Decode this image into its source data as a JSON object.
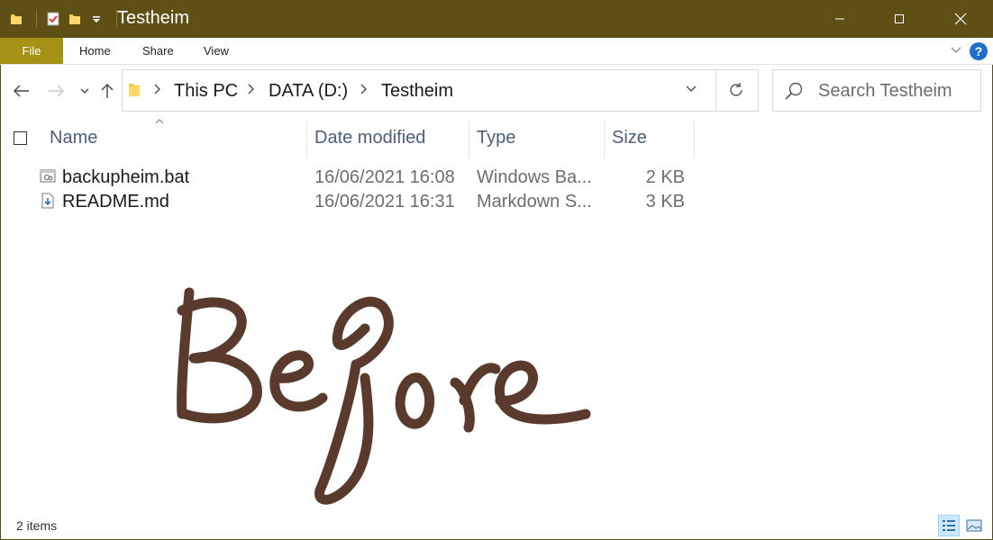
{
  "window": {
    "title": "Testheim",
    "title_bar_color": "#5e4f15",
    "accent_color": "#a59115"
  },
  "quick_access": {
    "icons": [
      "folder-icon",
      "properties-icon",
      "new-folder-icon",
      "customize-dropdown-icon"
    ]
  },
  "ribbon": {
    "tabs": [
      {
        "label": "File",
        "active": true
      },
      {
        "label": "Home"
      },
      {
        "label": "Share"
      },
      {
        "label": "View"
      }
    ],
    "help_label": "?"
  },
  "address_bar": {
    "breadcrumbs": [
      "This PC",
      "DATA (D:)",
      "Testheim"
    ]
  },
  "search": {
    "placeholder": "Search Testheim"
  },
  "columns": {
    "name": "Name",
    "date_modified": "Date modified",
    "type": "Type",
    "size": "Size"
  },
  "files": [
    {
      "name": "backupheim.bat",
      "date": "16/06/2021 16:08",
      "type": "Windows Ba...",
      "size": "2 KB",
      "icon": "batch-file-icon"
    },
    {
      "name": "README.md",
      "date": "16/06/2021 16:31",
      "type": "Markdown S...",
      "size": "3 KB",
      "icon": "markdown-file-icon"
    }
  ],
  "drawing": {
    "text": "Before",
    "color": "#5b3a2e"
  },
  "status_bar": {
    "item_count": "2 items",
    "active_view": "details"
  }
}
